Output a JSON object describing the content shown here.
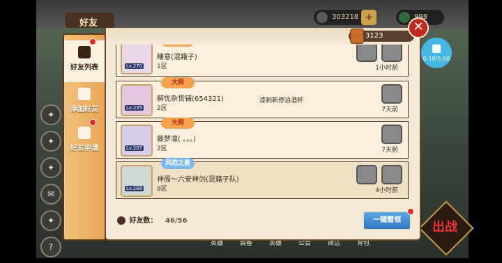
{
  "hud": {
    "currency_value": "303218",
    "secondary_value": "998"
  },
  "header": {
    "title": "好友"
  },
  "sidebar": {
    "tabs": [
      {
        "label": "好友列表"
      },
      {
        "label": "添加好友"
      },
      {
        "label": "好友申请"
      }
    ]
  },
  "panel": {
    "coins": "3123"
  },
  "friends": [
    {
      "level": "Lv.270",
      "name": "睡意(混籍子)",
      "server": "1区",
      "signature": "",
      "last_online": "1小时前",
      "badge": "大师",
      "badge_color": "orange"
    },
    {
      "level": "Lv.235",
      "name": "解忧杂货铺(654321)",
      "server": "2区",
      "signature": "漆刺新停泊酒杯",
      "last_online": "7天前",
      "badge": "大师",
      "badge_color": "orange"
    },
    {
      "level": "Lv.207",
      "name": "藤梦凛( 。。。)",
      "server": "2区",
      "signature": "",
      "last_online": "7天前",
      "badge": "大师",
      "badge_color": "orange"
    },
    {
      "level": "Lv.268",
      "name": "神阁～六安神剑(混籍子队)",
      "server": "8区",
      "signature": "",
      "last_online": "4小时前",
      "badge": "风范之星",
      "badge_color": "blue"
    }
  ],
  "footer": {
    "friend_count_label": "好友数：",
    "friend_count_value": "46/56",
    "gift_all_label": "一键赠领"
  },
  "recorder": {
    "time": "0:10/5:00"
  },
  "bottom_nav": [
    "英雄",
    "装备",
    "英雄",
    "公会",
    "商店",
    "背包"
  ],
  "battle_label": "出战"
}
